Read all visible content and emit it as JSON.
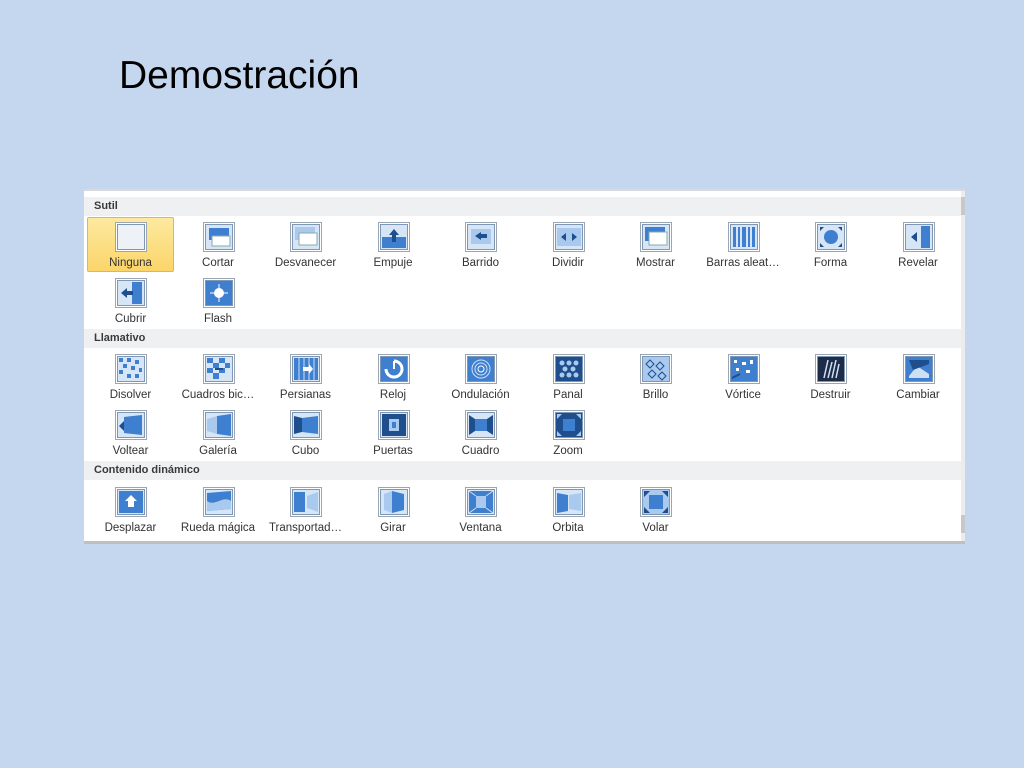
{
  "slide": {
    "title": "Demostración"
  },
  "gallery": {
    "sections": [
      {
        "name": "Sutil",
        "items": [
          {
            "label": "Ninguna",
            "icon": "none-icon",
            "selected": true
          },
          {
            "label": "Cortar",
            "icon": "cut-icon"
          },
          {
            "label": "Desvanecer",
            "icon": "fade-icon"
          },
          {
            "label": "Empuje",
            "icon": "push-icon"
          },
          {
            "label": "Barrido",
            "icon": "wipe-icon"
          },
          {
            "label": "Dividir",
            "icon": "split-icon"
          },
          {
            "label": "Mostrar",
            "icon": "reveal-slides-icon"
          },
          {
            "label": "Barras aleat…",
            "icon": "random-bars-icon"
          },
          {
            "label": "Forma",
            "icon": "shape-icon"
          },
          {
            "label": "Revelar",
            "icon": "uncover-icon"
          },
          {
            "label": "Cubrir",
            "icon": "cover-icon"
          },
          {
            "label": "Flash",
            "icon": "flash-icon"
          }
        ]
      },
      {
        "name": "Llamativo",
        "items": [
          {
            "label": "Disolver",
            "icon": "dissolve-icon"
          },
          {
            "label": "Cuadros bic…",
            "icon": "checkerboard-icon"
          },
          {
            "label": "Persianas",
            "icon": "blinds-icon"
          },
          {
            "label": "Reloj",
            "icon": "clock-icon"
          },
          {
            "label": "Ondulación",
            "icon": "ripple-icon"
          },
          {
            "label": "Panal",
            "icon": "honeycomb-icon"
          },
          {
            "label": "Brillo",
            "icon": "glitter-icon"
          },
          {
            "label": "Vórtice",
            "icon": "vortex-icon"
          },
          {
            "label": "Destruir",
            "icon": "shred-icon"
          },
          {
            "label": "Cambiar",
            "icon": "switch-icon"
          },
          {
            "label": "Voltear",
            "icon": "flip-icon"
          },
          {
            "label": "Galería",
            "icon": "gallery-icon"
          },
          {
            "label": "Cubo",
            "icon": "cube-icon"
          },
          {
            "label": "Puertas",
            "icon": "doors-icon"
          },
          {
            "label": "Cuadro",
            "icon": "box-icon"
          },
          {
            "label": "Zoom",
            "icon": "zoom-icon"
          }
        ]
      },
      {
        "name": "Contenido dinámico",
        "items": [
          {
            "label": "Desplazar",
            "icon": "pan-icon"
          },
          {
            "label": "Rueda mágica",
            "icon": "ferris-wheel-icon"
          },
          {
            "label": "Transportad…",
            "icon": "conveyor-icon"
          },
          {
            "label": "Girar",
            "icon": "rotate-icon"
          },
          {
            "label": "Ventana",
            "icon": "window-icon"
          },
          {
            "label": "Órbita",
            "icon": "orbit-icon"
          },
          {
            "label": "Volar",
            "icon": "fly-through-icon"
          }
        ]
      }
    ]
  },
  "colors": {
    "background": "#c5d7ef",
    "selected": "#fbd569",
    "icon_blue": "#3f7fd0"
  }
}
